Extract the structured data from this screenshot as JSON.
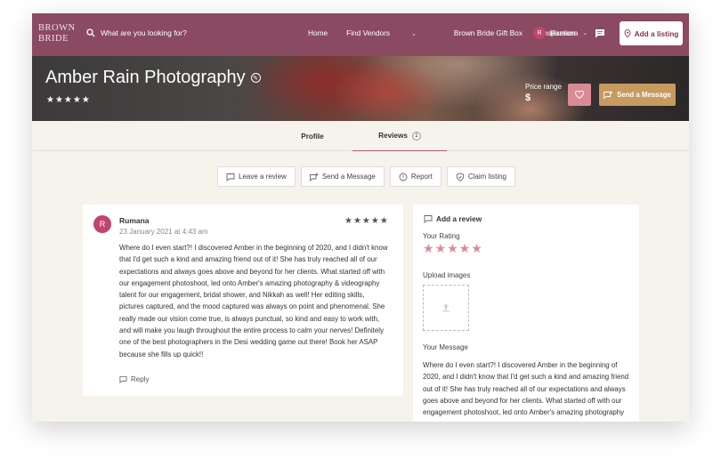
{
  "nav": {
    "logo_line1": "BROWN",
    "logo_line2": "BRIDE",
    "search_placeholder": "What are you looking for?",
    "links": [
      "Home",
      "Find Vendors",
      "Brown Bride Gift Box",
      "Inspiration"
    ],
    "user_initial": "R",
    "user_name": "Rumana",
    "add_listing": "Add a listing"
  },
  "hero": {
    "title": "Amber Rain Photography",
    "stars": "★★★★★",
    "price_label": "Price range",
    "price_value": "$",
    "message_button": "Send a Message"
  },
  "tabs": {
    "profile": "Profile",
    "reviews": "Reviews",
    "reviews_count": "1"
  },
  "actions": {
    "leave_review": "Leave a review",
    "send_message": "Send a Message",
    "report": "Report",
    "claim": "Claim listing"
  },
  "review": {
    "initial": "R",
    "name": "Rumana",
    "date": "23 January 2021 at 4:43 am",
    "stars": "★★★★★",
    "lines": [
      "Where do I even start?! I discovered Amber in the beginning of 2020, and I didn't know",
      "that I'd get such a kind and amazing friend out of it! She has truly reached all of our",
      "expectations and always goes above and beyond for her clients. What started off with",
      "our engagement photoshoot, led onto Amber's amazing photography & videography",
      "talent for our engagement, bridal shower, and Nikkah as well! Her editing skills,",
      "pictures captured, and the mood captured was always on point and phenomenal. She",
      "really made our vision come true, is always punctual, so kind and easy to work with,",
      "and will make you laugh throughout the entire process to calm your nerves! Definitely",
      "one of the best photographers in the Desi wedding game out there! Book her ASAP",
      "because she fills up quick!!"
    ],
    "reply": "Reply"
  },
  "add_review": {
    "title": "Add a review",
    "rating_label": "Your Rating",
    "stars": "★★★★★",
    "upload_label": "Upload images",
    "message_label": "Your Message",
    "message_lines": [
      "Where do I even start?! I discovered Amber in the beginning of",
      "2020, and I didn't know that I'd get such a kind and amazing friend",
      "out of it! She has truly reached all of our expectations and always",
      "goes above and beyond for her clients. What started off with our",
      "engagement photoshoot, led onto Amber's amazing photography"
    ]
  },
  "colors": {
    "nav_bg": "#8a4a62",
    "accent_pink": "#d98b95",
    "accent_gold": "#c79a5f"
  }
}
